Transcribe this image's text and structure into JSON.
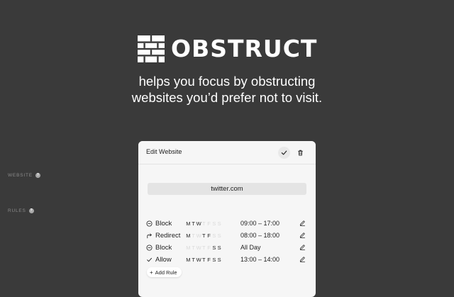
{
  "brand": {
    "name": "OBSTRUCT",
    "tagline_line1": "helps you focus by obstructing",
    "tagline_line2": "websites you’d prefer not to visit."
  },
  "colors": {
    "background": "#3a3a3a",
    "card": "#f6f6f6",
    "input": "#e4e4e4",
    "day_active": "#222222",
    "day_inactive": "#dadada"
  },
  "edit_panel": {
    "title": "Edit Website",
    "confirm_icon": "check-icon",
    "delete_icon": "trash-icon",
    "website_label": "WEBSITE",
    "website_value": "twitter.com",
    "rules_label": "RULES",
    "rules": [
      {
        "action": "Block",
        "icon": "minus-circle-icon",
        "days": [
          {
            "letter": "M",
            "active": true
          },
          {
            "letter": "T",
            "active": true
          },
          {
            "letter": "W",
            "active": true
          },
          {
            "letter": "T",
            "active": false
          },
          {
            "letter": "F",
            "active": false
          },
          {
            "letter": "S",
            "active": false
          },
          {
            "letter": "S",
            "active": false
          }
        ],
        "time": "09:00 – 17:00"
      },
      {
        "action": "Redirect",
        "icon": "redirect-arrow-icon",
        "days": [
          {
            "letter": "M",
            "active": true
          },
          {
            "letter": "T",
            "active": false
          },
          {
            "letter": "W",
            "active": false
          },
          {
            "letter": "T",
            "active": true
          },
          {
            "letter": "F",
            "active": true
          },
          {
            "letter": "S",
            "active": false
          },
          {
            "letter": "S",
            "active": false
          }
        ],
        "time": "08:00 – 18:00"
      },
      {
        "action": "Block",
        "icon": "minus-circle-icon",
        "days": [
          {
            "letter": "M",
            "active": false
          },
          {
            "letter": "T",
            "active": false
          },
          {
            "letter": "W",
            "active": false
          },
          {
            "letter": "T",
            "active": false
          },
          {
            "letter": "F",
            "active": false
          },
          {
            "letter": "S",
            "active": true
          },
          {
            "letter": "S",
            "active": true
          }
        ],
        "time": "All Day"
      },
      {
        "action": "Allow",
        "icon": "check-icon",
        "days": [
          {
            "letter": "M",
            "active": true
          },
          {
            "letter": "T",
            "active": true
          },
          {
            "letter": "W",
            "active": true
          },
          {
            "letter": "T",
            "active": true
          },
          {
            "letter": "F",
            "active": true
          },
          {
            "letter": "S",
            "active": true
          },
          {
            "letter": "S",
            "active": true
          }
        ],
        "time": "13:00 – 14:00"
      }
    ],
    "add_rule_label": "Add Rule"
  }
}
